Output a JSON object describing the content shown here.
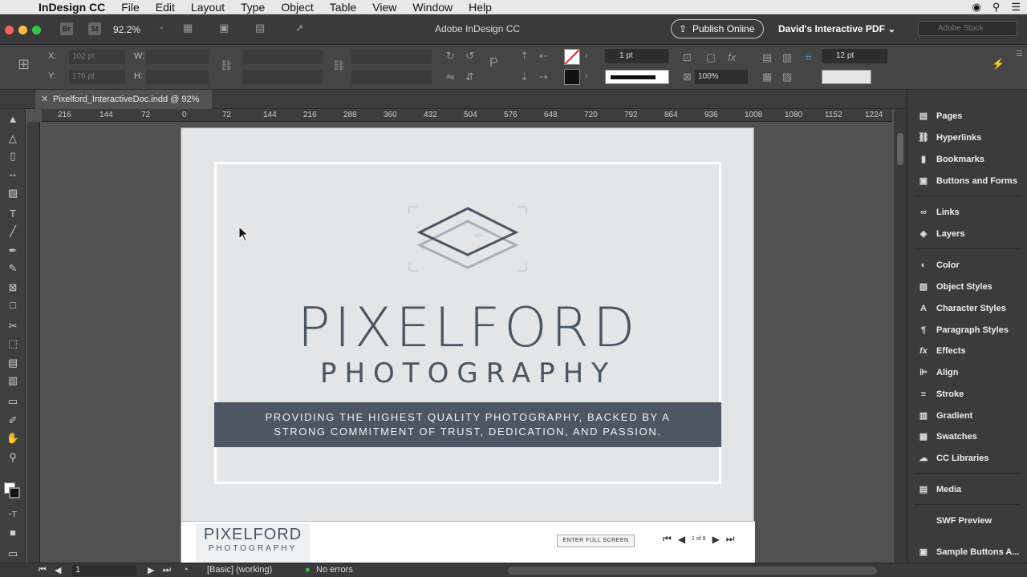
{
  "menubar": {
    "app_name": "InDesign CC",
    "items": [
      "File",
      "Edit",
      "Layout",
      "Type",
      "Object",
      "Table",
      "View",
      "Window",
      "Help"
    ]
  },
  "appbar": {
    "bridge_label": "Br",
    "stock_label": "St",
    "zoom": "92.2%",
    "title": "Adobe InDesign CC",
    "publish_label": "Publish Online",
    "workspace": "David's Interactive PDF",
    "stock_placeholder": "Adobe Stock"
  },
  "controlbar": {
    "x_label": "X:",
    "x_value": "102 pt",
    "y_label": "Y:",
    "y_value": "176 pt",
    "w_label": "W:",
    "h_label": "H:",
    "stroke_weight": "1 pt",
    "opacity": "100%",
    "corner_size": "12 pt"
  },
  "document_tab": {
    "label": "Pixelford_InteractiveDoc.indd @ 92%"
  },
  "ruler": {
    "ticks": [
      "216",
      "144",
      "72",
      "0",
      "72",
      "144",
      "216",
      "288",
      "360",
      "432",
      "504",
      "576",
      "648",
      "720",
      "792",
      "864",
      "936",
      "1008",
      "1080",
      "1152",
      "1224"
    ]
  },
  "document": {
    "brand": "PIXELFORD",
    "brand_sub": "PHOTOGRAPHY",
    "tagline_line1": "PROVIDING THE HIGHEST QUALITY PHOTOGRAPHY, BACKED BY A",
    "tagline_line2": "STRONG COMMITMENT OF TRUST, DEDICATION, AND PASSION.",
    "footer_logo_top": "PIXELFORD",
    "footer_logo_bottom": "PHOTOGRAPHY",
    "fullscreen_button": "ENTER FULL SCREEN",
    "page_indicator": "1 of 9",
    "colors": {
      "page_bg": "#e4e5e6",
      "brand_text": "#4b5563",
      "tagline_bg": "#4d5763"
    }
  },
  "panels": {
    "items": [
      {
        "label": "Pages",
        "icon": "pages-icon"
      },
      {
        "label": "Hyperlinks",
        "icon": "hyperlinks-icon"
      },
      {
        "label": "Bookmarks",
        "icon": "bookmarks-icon"
      },
      {
        "label": "Buttons and Forms",
        "icon": "buttons-forms-icon"
      },
      {
        "label": "Links",
        "icon": "links-icon"
      },
      {
        "label": "Layers",
        "icon": "layers-icon"
      },
      {
        "label": "Color",
        "icon": "color-icon"
      },
      {
        "label": "Object Styles",
        "icon": "object-styles-icon"
      },
      {
        "label": "Character Styles",
        "icon": "character-styles-icon"
      },
      {
        "label": "Paragraph Styles",
        "icon": "paragraph-styles-icon"
      },
      {
        "label": "Effects",
        "icon": "effects-icon"
      },
      {
        "label": "Align",
        "icon": "align-icon"
      },
      {
        "label": "Stroke",
        "icon": "stroke-icon"
      },
      {
        "label": "Gradient",
        "icon": "gradient-icon"
      },
      {
        "label": "Swatches",
        "icon": "swatches-icon"
      },
      {
        "label": "CC Libraries",
        "icon": "cc-libraries-icon"
      },
      {
        "label": "Media",
        "icon": "media-icon"
      },
      {
        "label": "SWF Preview",
        "icon": "swf-preview-icon"
      },
      {
        "label": "Sample Buttons A...",
        "icon": "sample-buttons-icon"
      }
    ]
  },
  "statusbar": {
    "page": "1",
    "style": "[Basic] (working)",
    "errors": "No errors"
  }
}
